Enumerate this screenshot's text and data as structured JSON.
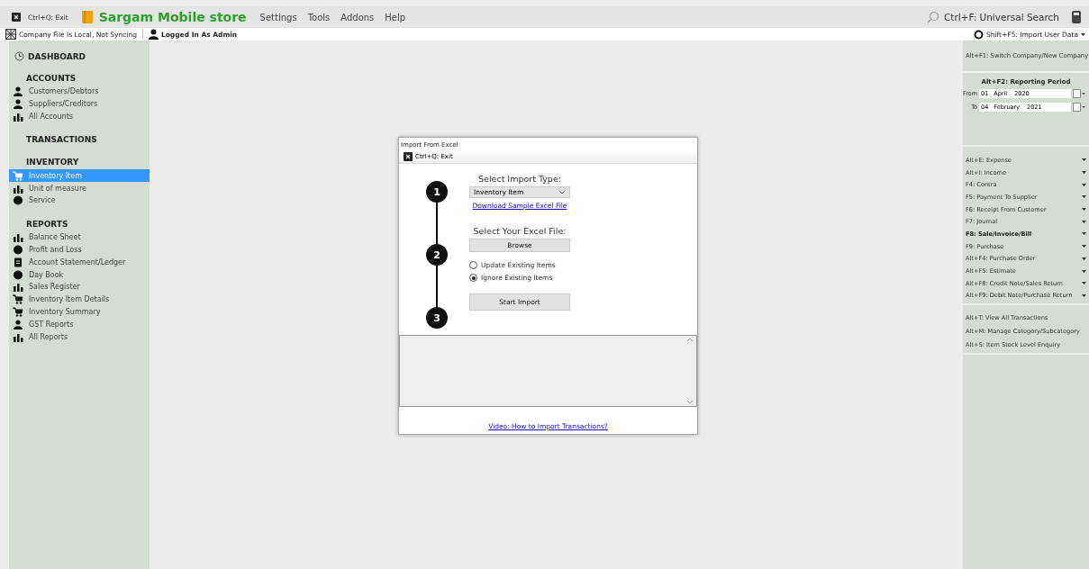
{
  "menubar": {
    "exit": "Ctrl+Q: Exit",
    "app_title": "Sargam Mobile store",
    "menus": [
      "Settings",
      "Tools",
      "Addons",
      "Help"
    ],
    "search": "Ctrl+F: Universal Search"
  },
  "status_bar": {
    "sync": "Company File Is Local, Not Syncing",
    "user": "Logged In As Admin",
    "import": "Shift+F5: Import User Data"
  },
  "sidebar": {
    "dashboard": "DASHBOARD",
    "sections": [
      {
        "title": "ACCOUNTS",
        "items": [
          {
            "label": "Customers/Debtors",
            "selected": false
          },
          {
            "label": "Suppliers/Creditors",
            "selected": false
          },
          {
            "label": "All Accounts",
            "selected": false
          }
        ]
      },
      {
        "title": "TRANSACTIONS"
      },
      {
        "title": "INVENTORY",
        "items": [
          {
            "label": "Inventory Item",
            "selected": true
          },
          {
            "label": "Unit of measure",
            "selected": false
          },
          {
            "label": "Service",
            "selected": false
          }
        ]
      },
      {
        "title": "REPORTS",
        "items": [
          {
            "label": "Balance Sheet",
            "selected": false
          },
          {
            "label": "Profit and Loss",
            "selected": false
          },
          {
            "label": "Account Statement/Ledger",
            "selected": false
          },
          {
            "label": "Day Book",
            "selected": false
          },
          {
            "label": "Sales Register",
            "selected": false
          },
          {
            "label": "Inventory Item Details",
            "selected": false
          },
          {
            "label": "Inventory Summary",
            "selected": false
          },
          {
            "label": "GST Reports",
            "selected": false
          },
          {
            "label": "All Reports",
            "selected": false
          }
        ]
      }
    ]
  },
  "dialog": {
    "title": "Import From Excel",
    "exit": "Ctrl+Q: Exit",
    "steps": [
      "1",
      "2",
      "3"
    ],
    "import_type_label": "Select Import Type:",
    "import_type": "Inventory Item",
    "sample_link": "Download Sample Excel File",
    "file_label": "Select Your Excel File:",
    "browse": "Browse",
    "options": [
      {
        "label": "Update Existing Items",
        "selected": false
      },
      {
        "label": "Ignore Existing Items",
        "selected": true
      }
    ],
    "start": "Start Import",
    "video_link": "Video: How to Import Transactions?"
  },
  "right_panel": {
    "switch": "Alt+F1: Switch Company/New Company",
    "period_title": "Alt+F2: Reporting Period",
    "from": {
      "label": "From",
      "day": "01",
      "month": "April",
      "year": "2020"
    },
    "to": {
      "label": "To",
      "day": "04",
      "month": "February",
      "year": "2021"
    },
    "actions": [
      {
        "label": "Alt+E: Expense",
        "bold": false
      },
      {
        "label": "Alt+I: Income",
        "bold": false
      },
      {
        "label": "F4: Contra",
        "bold": false
      },
      {
        "label": "F5: Payment To Supplier",
        "bold": false
      },
      {
        "label": "F6: Receipt From Customer",
        "bold": false
      },
      {
        "label": "F7: Journal",
        "bold": false
      },
      {
        "label": "F8: Sale/Invoice/Bill",
        "bold": true
      },
      {
        "label": "F9: Purchase",
        "bold": false
      },
      {
        "label": "Alt+F4: Purchase Order",
        "bold": false
      },
      {
        "label": "Alt+F5: Estimate",
        "bold": false
      },
      {
        "label": "Alt+F8: Credit Note/Sales Return",
        "bold": false
      },
      {
        "label": "Alt+F9: Debit Note/Purchase Return",
        "bold": false
      }
    ],
    "links": [
      "Alt+T: View All Transactions",
      "Alt+M: Manage Category/Subcategory",
      "Alt+S: Item Stock Level Enquiry"
    ]
  }
}
